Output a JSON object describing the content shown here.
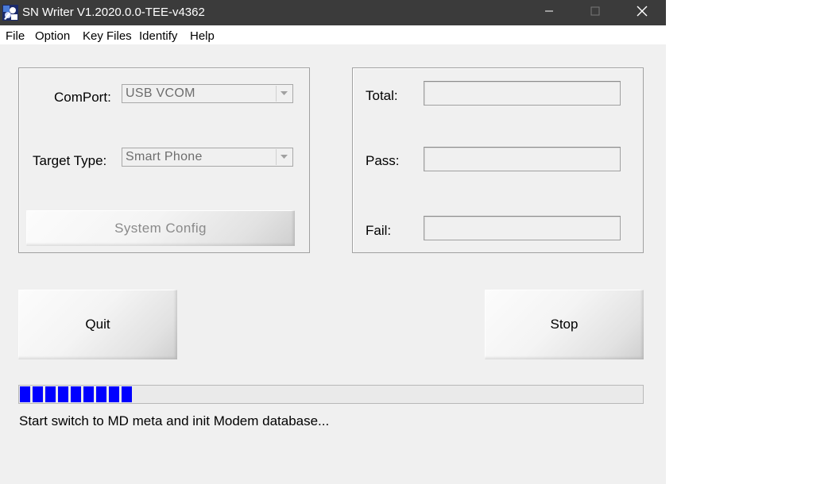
{
  "window": {
    "title": "SN Writer V1.2020.0.0-TEE-v4362"
  },
  "icons": {
    "app": "sn-writer-app-icon",
    "minimize": "minimize-icon",
    "maximize": "maximize-icon",
    "close": "close-icon",
    "dropdown": "chevron-down-icon"
  },
  "menu": {
    "items": [
      "File",
      "Option",
      "Key Files",
      "Identify",
      "Help"
    ]
  },
  "config": {
    "comport_label": "ComPort:",
    "comport_value": "USB VCOM",
    "target_type_label": "Target Type:",
    "target_type_value": "Smart Phone",
    "system_config_label": "System Config"
  },
  "stats": {
    "total_label": "Total:",
    "pass_label": "Pass:",
    "fail_label": "Fail:",
    "total_value": "",
    "pass_value": "",
    "fail_value": ""
  },
  "actions": {
    "quit_label": "Quit",
    "stop_label": "Stop"
  },
  "progress": {
    "blocks_filled": 9,
    "fraction": 0.18,
    "color": "#0000ff"
  },
  "status": {
    "message": "Start switch to MD meta and init Modem database..."
  },
  "colors": {
    "titlebar": "#3b3b3b",
    "window_bg": "#f0f0f0",
    "progress": "#0000ff"
  }
}
